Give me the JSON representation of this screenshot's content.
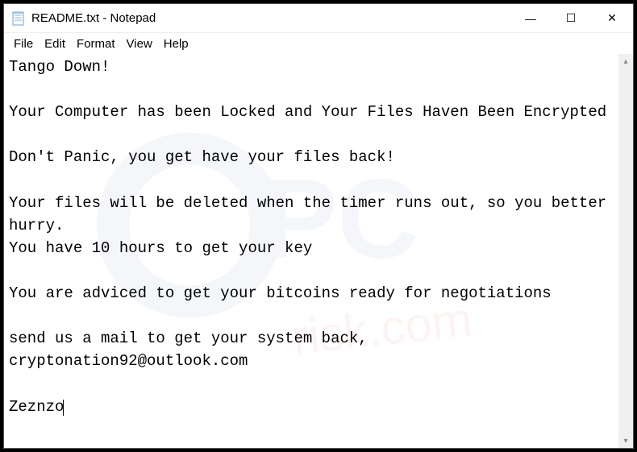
{
  "window": {
    "title": "README.txt - Notepad"
  },
  "menu": {
    "file": "File",
    "edit": "Edit",
    "format": "Format",
    "view": "View",
    "help": "Help"
  },
  "content": {
    "body": "Tango Down!\n\nYour Computer has been Locked and Your Files Haven Been Encrypted\n\nDon't Panic, you get have your files back!\n\nYour files will be deleted when the timer runs out, so you better hurry.\nYou have 10 hours to get your key\n\nYou are adviced to get your bitcoins ready for negotiations\n\nsend us a mail to get your system back, cryptonation92@outlook.com\n\nZeznzo"
  },
  "icons": {
    "minimize": "—",
    "maximize": "☐",
    "close": "✕",
    "scroll_up": "▴",
    "scroll_down": "▾"
  }
}
